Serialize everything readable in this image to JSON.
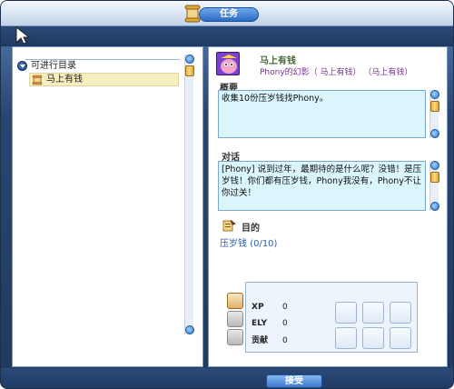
{
  "window": {
    "title": "任务"
  },
  "quest_list": {
    "root_label": "可进行目录",
    "items": [
      {
        "label": "马上有钱",
        "selected": true
      }
    ]
  },
  "quest": {
    "title": "马上有钱",
    "subtitle": "Phony的幻影（ 马上有钱）  （马上有钱）",
    "summary_label": "概要",
    "summary_text": "收集10份压岁钱找Phony。",
    "dialog_label": "对话",
    "dialog_text": "[Phony] 说到过年，最期待的是什么呢？没错！是压岁钱！你们都有压岁钱，Phony我没有，Phony不让你过关！",
    "goal_label": "目的",
    "goal_items": [
      {
        "name": "压岁钱",
        "progress": "(0/10)"
      }
    ],
    "rewards": {
      "xp_label": "XP",
      "xp_value": "0",
      "ely_label": "ELY",
      "ely_value": "0",
      "contribution_label": "贡献",
      "contribution_value": "0"
    }
  },
  "footer": {
    "accept_label": "接受"
  },
  "icons": {
    "title": "scroll-icon",
    "cursor": "cursor-icon",
    "tree_root": "expand-bullet-icon",
    "tree_item": "scroll-icon",
    "goal": "quest-goal-icon",
    "avatar": "npc-phony-avatar"
  },
  "colors": {
    "frame": "#27466f",
    "title_pill": "#2c6cc6",
    "text_box": "#daf5fc",
    "selected_item": "#f6f0c0",
    "quest_subtitle": "#7a2f95",
    "goal_item": "#2b5fa8"
  }
}
